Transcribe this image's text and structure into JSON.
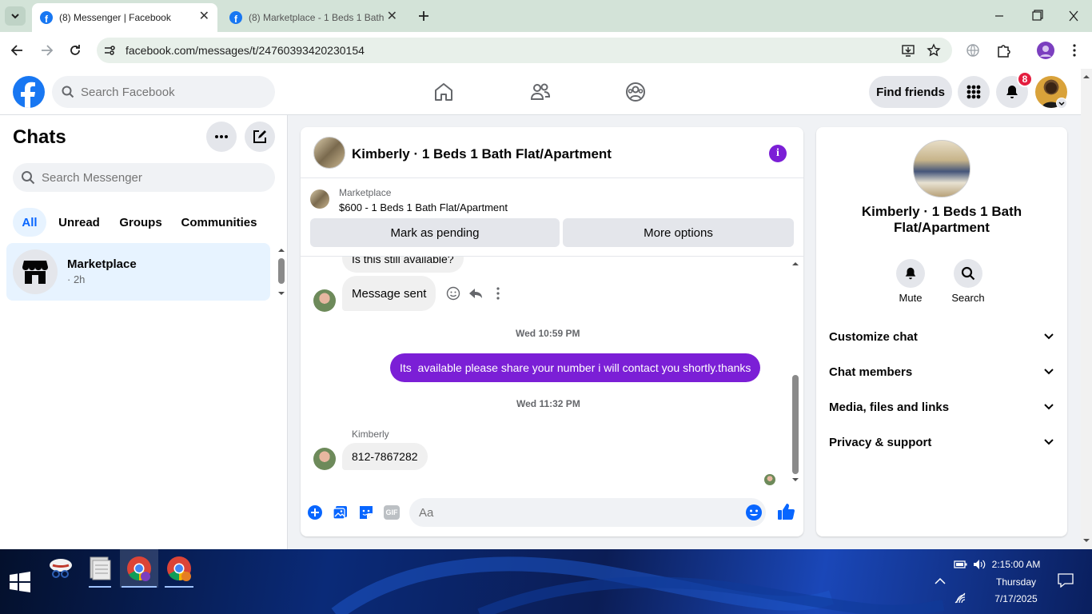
{
  "browser": {
    "tabs": [
      {
        "title": "(8) Messenger | Facebook"
      },
      {
        "title": "(8) Marketplace - 1 Beds 1 Bath"
      }
    ],
    "url": "facebook.com/messages/t/24760393420230154"
  },
  "fb_header": {
    "search_placeholder": "Search Facebook",
    "find_friends": "Find friends",
    "notification_count": "8"
  },
  "chats": {
    "title": "Chats",
    "search_placeholder": "Search Messenger",
    "filters": [
      "All",
      "Unread",
      "Groups",
      "Communities"
    ],
    "active_filter": "All",
    "items": [
      {
        "name": "Marketplace",
        "meta": "· 2h"
      }
    ]
  },
  "conversation": {
    "title": "Kimberly · 1 Beds 1 Bath Flat/Apartment",
    "listing_source": "Marketplace",
    "listing_title": "$600 - 1 Beds 1 Bath Flat/Apartment",
    "mark_pending": "Mark as pending",
    "more_options": "More options",
    "messages": [
      {
        "text": "Is this still available?"
      },
      {
        "text": "Message sent"
      },
      {
        "time": "Wed 10:59 PM"
      },
      {
        "text": "Its  available please share your number i will contact you shortly.thanks"
      },
      {
        "time": "Wed 11:32 PM"
      },
      {
        "sender": "Kimberly",
        "text": "812-7867282"
      }
    ],
    "composer_placeholder": "Aa",
    "accent": "#7b1fd6"
  },
  "profile": {
    "name": "Kimberly · 1 Beds 1 Bath Flat/Apartment",
    "mute": "Mute",
    "search": "Search",
    "sections": [
      "Customize chat",
      "Chat members",
      "Media, files and links",
      "Privacy & support"
    ]
  },
  "taskbar": {
    "time": "2:15:00 AM",
    "day": "Thursday",
    "date": "7/17/2025"
  }
}
